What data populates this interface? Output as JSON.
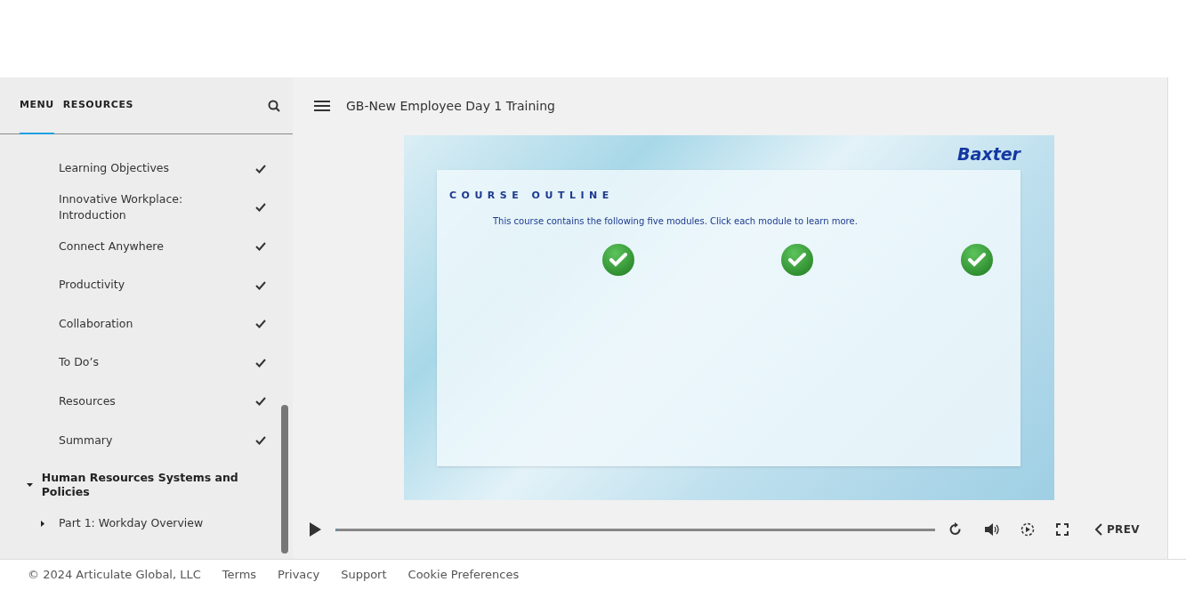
{
  "sidebar": {
    "tabs": [
      {
        "label": "MENU",
        "selected": true
      },
      {
        "label": "RESOURCES",
        "selected": false
      }
    ],
    "items": [
      {
        "kind": "lesson",
        "label": "Learning Objectives",
        "completed": true
      },
      {
        "kind": "lesson",
        "label": "Innovative Workplace: Introduction",
        "completed": true
      },
      {
        "kind": "lesson",
        "label": "Connect Anywhere",
        "completed": true
      },
      {
        "kind": "lesson",
        "label": "Productivity",
        "completed": true
      },
      {
        "kind": "lesson",
        "label": "Collaboration",
        "completed": true
      },
      {
        "kind": "lesson",
        "label": "To Do’s",
        "completed": true
      },
      {
        "kind": "lesson",
        "label": "Resources",
        "completed": true
      },
      {
        "kind": "lesson",
        "label": "Summary",
        "completed": true
      },
      {
        "kind": "section",
        "label": "Human Resources Systems and Policies",
        "expanded": true,
        "children": [
          {
            "kind": "subsection",
            "label": "Part 1: Workday Overview",
            "expanded": false
          }
        ]
      }
    ]
  },
  "course": {
    "title": "GB-New Employee Day 1 Training"
  },
  "slide": {
    "logo": "Baxter",
    "heading": "COURSE OUTLINE",
    "intro": "This course contains the following five modules. Click each module to learn more.",
    "modules": [
      {
        "completed": true
      },
      {
        "completed": true
      },
      {
        "completed": true
      }
    ]
  },
  "player": {
    "level": 0.002,
    "prev_label": "PREV"
  },
  "footer": {
    "copyright": "© 2024 Articulate Global, LLC",
    "links": [
      "Terms",
      "Privacy",
      "Support",
      "Cookie Preferences"
    ]
  }
}
